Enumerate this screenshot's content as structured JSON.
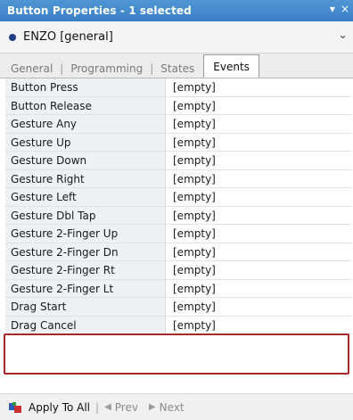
{
  "titlebar": {
    "title": "Button Properties - 1 selected",
    "pin_icon": "▾",
    "close_icon": "×"
  },
  "selector": {
    "value": "ENZO  [general]",
    "chevron": "⌄"
  },
  "tabs": [
    {
      "label": "General"
    },
    {
      "label": "Programming"
    },
    {
      "label": "States"
    },
    {
      "label": "Events",
      "active": true
    }
  ],
  "events": [
    {
      "name": "Button Press",
      "value": "[empty]"
    },
    {
      "name": "Button Release",
      "value": "[empty]"
    },
    {
      "name": "Gesture Any",
      "value": "[empty]"
    },
    {
      "name": "Gesture Up",
      "value": "[empty]"
    },
    {
      "name": "Gesture Down",
      "value": "[empty]"
    },
    {
      "name": "Gesture Right",
      "value": "[empty]"
    },
    {
      "name": "Gesture Left",
      "value": "[empty]"
    },
    {
      "name": "Gesture Dbl Tap",
      "value": "[empty]"
    },
    {
      "name": "Gesture 2-Finger Up",
      "value": "[empty]"
    },
    {
      "name": "Gesture 2-Finger Dn",
      "value": "[empty]"
    },
    {
      "name": "Gesture 2-Finger Rt",
      "value": "[empty]"
    },
    {
      "name": "Gesture 2-Finger Lt",
      "value": "[empty]"
    },
    {
      "name": "Drag Start",
      "value": "[empty]"
    },
    {
      "name": "Drag Cancel",
      "value": "[empty]"
    }
  ],
  "footer": {
    "apply_label": "Apply To All",
    "prev_label": "Prev",
    "next_label": "Next",
    "prev_arrow": "◀",
    "next_arrow": "▶"
  },
  "colors": {
    "titlebar": "#3a7fc4",
    "highlight_border": "#a8282c",
    "name_column_bg": "#eef0f3"
  }
}
